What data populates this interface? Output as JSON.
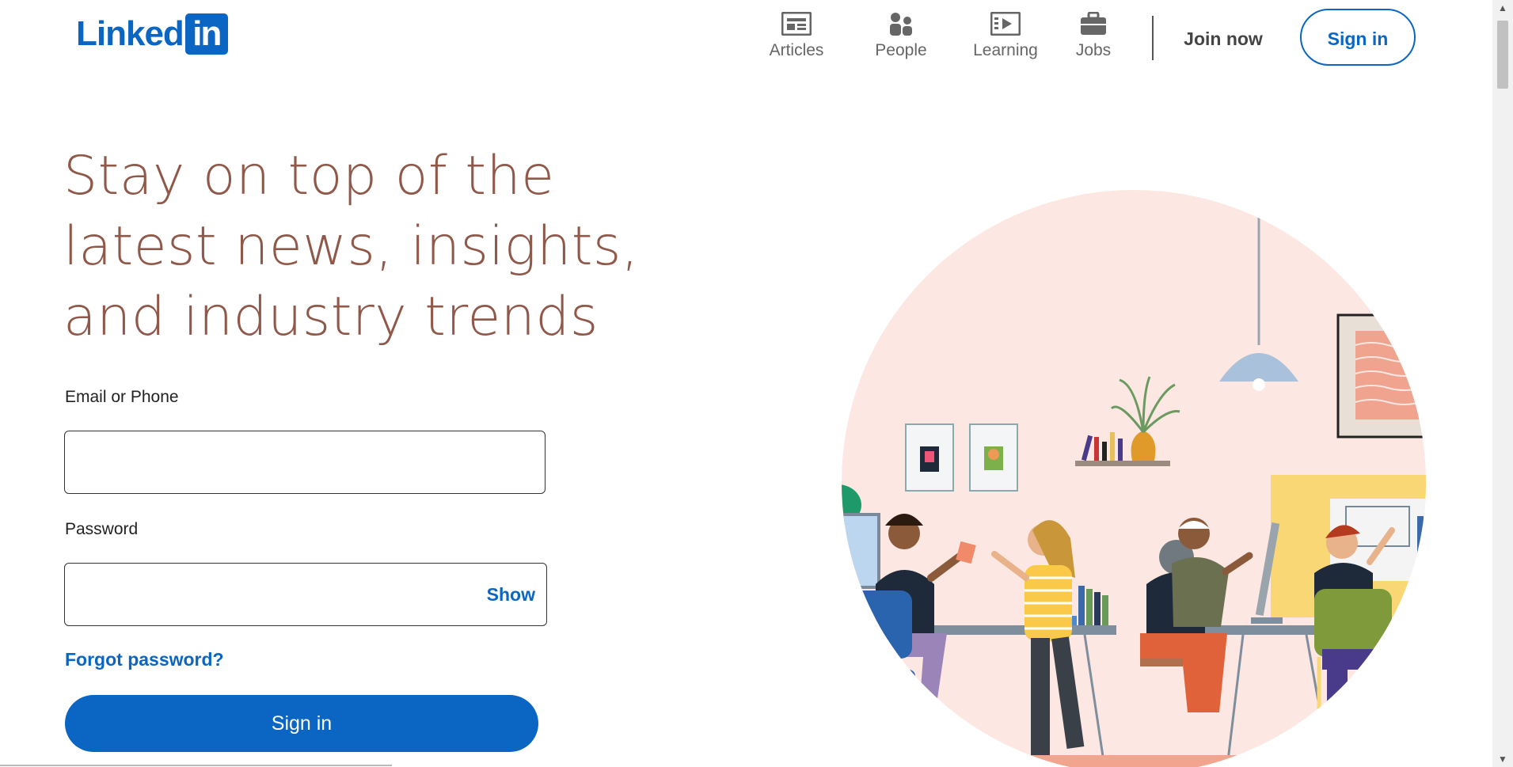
{
  "header": {
    "logo_text": "Linked",
    "logo_box_text": "in",
    "nav": [
      {
        "label": "Articles",
        "icon": "articles-icon"
      },
      {
        "label": "People",
        "icon": "people-icon"
      },
      {
        "label": "Learning",
        "icon": "learning-icon"
      },
      {
        "label": "Jobs",
        "icon": "jobs-icon"
      }
    ],
    "join_label": "Join now",
    "signin_label": "Sign in"
  },
  "hero": {
    "title_lines": [
      "Stay on top of the",
      "latest news, insights,",
      "and industry trends"
    ]
  },
  "form": {
    "email_label": "Email or Phone",
    "email_value": "",
    "password_label": "Password",
    "password_value": "",
    "show_label": "Show",
    "forgot_label": "Forgot password?",
    "submit_label": "Sign in"
  },
  "colors": {
    "brand": "#0a66c2",
    "headline": "#8f5849",
    "illustration_bg": "#fde7e2"
  }
}
